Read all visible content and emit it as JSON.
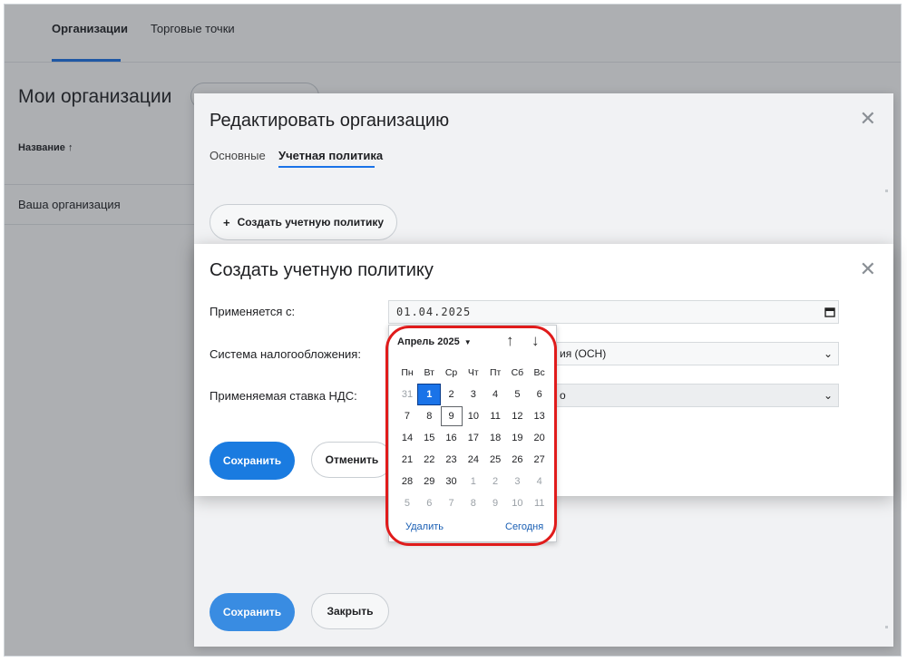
{
  "background": {
    "tabs": [
      {
        "label": "Организации",
        "active": true
      },
      {
        "label": "Торговые точки",
        "active": false
      }
    ],
    "title": "Мои организации",
    "table": {
      "column_name": "Название ↑",
      "rows": [
        "Ваша организация"
      ]
    }
  },
  "edit_dialog": {
    "title": "Редактировать организацию",
    "close_icon": "close-icon",
    "tabs": [
      {
        "label": "Основные",
        "active": false
      },
      {
        "label": "Учетная политика",
        "active": true
      }
    ],
    "create_policy_button": "Создать учетную политику",
    "save_button": "Сохранить",
    "close_button": "Закрыть"
  },
  "create_dialog": {
    "title": "Создать учетную политику",
    "fields": {
      "applies_from": {
        "label": "Применяется с:",
        "value": "01.04.2025"
      },
      "tax_system": {
        "label": "Система налогообложения:",
        "value_visible_tail": "ия (ОСН)"
      },
      "vat_rate": {
        "label": "Применяемая ставка НДС:",
        "value_visible_tail": "о"
      }
    },
    "save_button": "Сохранить",
    "cancel_button": "Отменить"
  },
  "date_picker": {
    "month_label": "Апрель 2025",
    "weekdays": [
      "Пн",
      "Вт",
      "Ср",
      "Чт",
      "Пт",
      "Сб",
      "Вс"
    ],
    "weeks": [
      [
        "31",
        "1",
        "2",
        "3",
        "4",
        "5",
        "6"
      ],
      [
        "7",
        "8",
        "9",
        "10",
        "11",
        "12",
        "13"
      ],
      [
        "14",
        "15",
        "16",
        "17",
        "18",
        "19",
        "20"
      ],
      [
        "21",
        "22",
        "23",
        "24",
        "25",
        "26",
        "27"
      ],
      [
        "28",
        "29",
        "30",
        "1",
        "2",
        "3",
        "4"
      ],
      [
        "5",
        "6",
        "7",
        "8",
        "9",
        "10",
        "11"
      ]
    ],
    "selected_day": "1",
    "today_day": "9",
    "clear_label": "Удалить",
    "today_label": "Сегодня"
  },
  "colors": {
    "accent": "#1a73e8",
    "primary_button": "#1a7be0",
    "highlight": "#e01b1b"
  }
}
